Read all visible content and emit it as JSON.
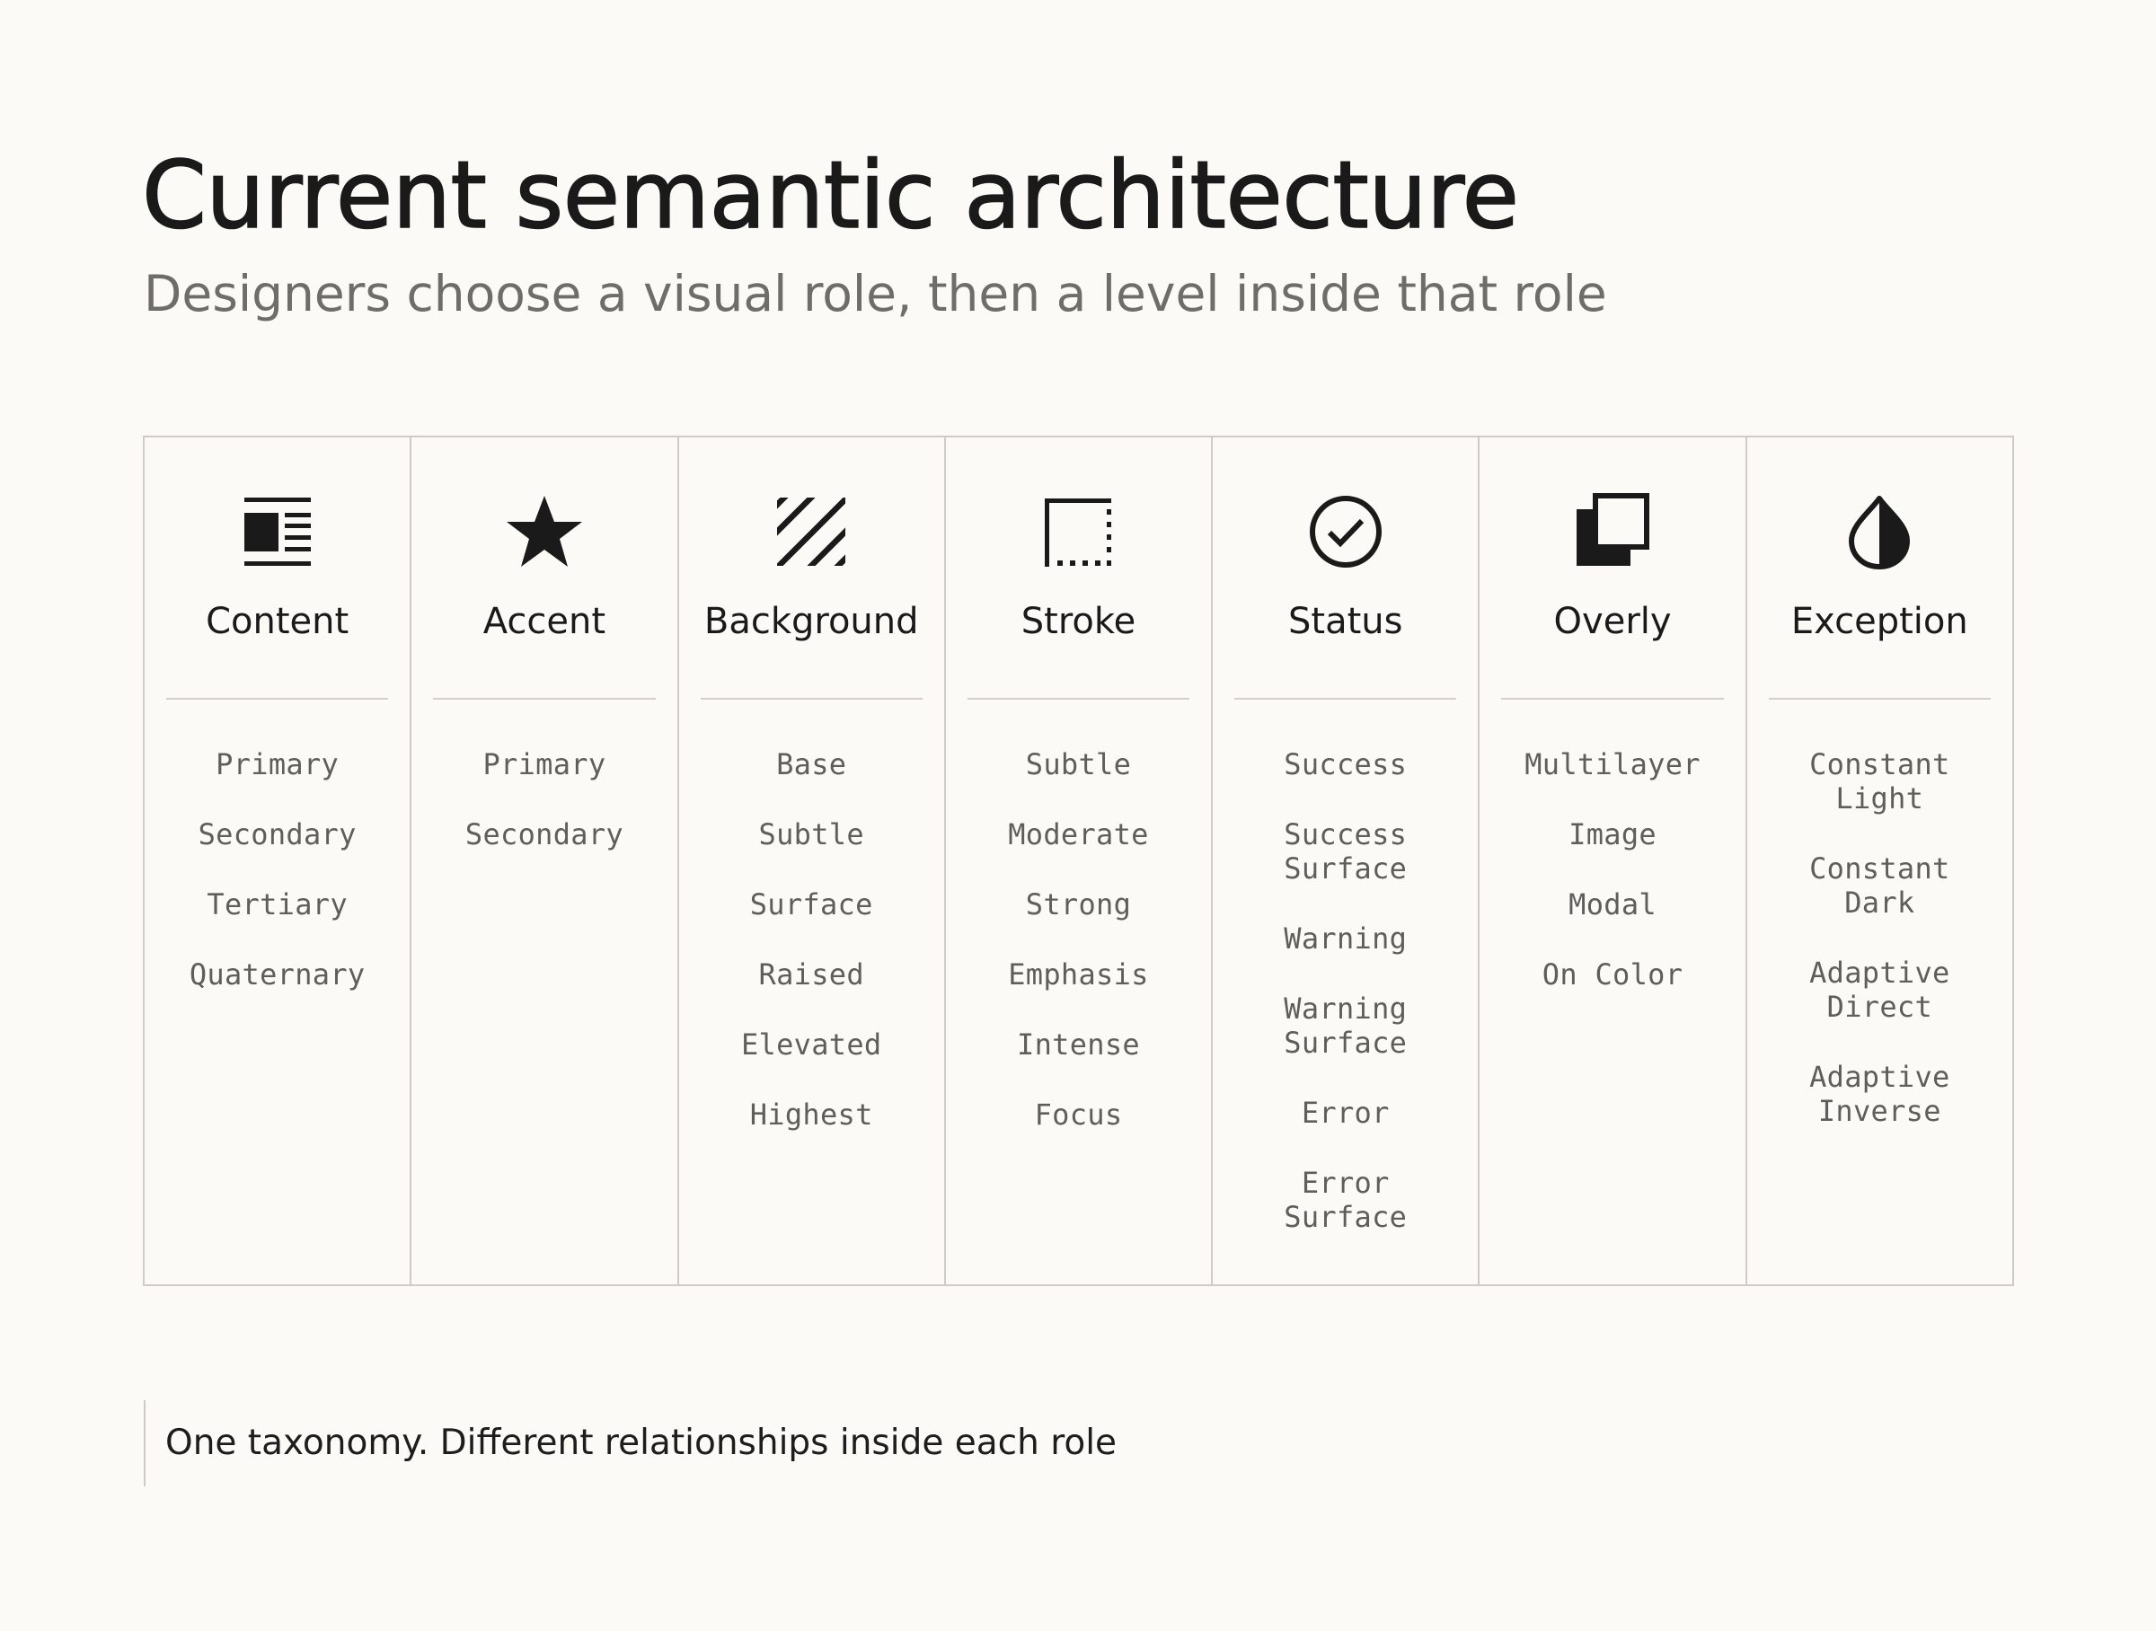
{
  "header": {
    "title": "Current semantic architecture",
    "subtitle": "Designers choose a visual role, then a level inside that role"
  },
  "roles": [
    {
      "name": "Content",
      "icon": "text-block-icon",
      "levels": [
        "Primary",
        "Secondary",
        "Tertiary",
        "Quaternary"
      ]
    },
    {
      "name": "Accent",
      "icon": "star-icon",
      "levels": [
        "Primary",
        "Secondary"
      ]
    },
    {
      "name": "Background",
      "icon": "diagonal-hatch-icon",
      "levels": [
        "Base",
        "Subtle",
        "Surface",
        "Raised",
        "Elevated",
        "Highest"
      ]
    },
    {
      "name": "Stroke",
      "icon": "partial-border-icon",
      "levels": [
        "Subtle",
        "Moderate",
        "Strong",
        "Emphasis",
        "Intense",
        "Focus"
      ]
    },
    {
      "name": "Status",
      "icon": "check-circle-icon",
      "levels": [
        "Success",
        "Success\nSurface",
        "Warning",
        "Warning\nSurface",
        "Error",
        "Error\nSurface"
      ]
    },
    {
      "name": "Overly",
      "icon": "stacked-layers-icon",
      "levels": [
        "Multilayer",
        "Image",
        "Modal",
        "On Color"
      ]
    },
    {
      "name": "Exception",
      "icon": "half-drop-icon",
      "levels": [
        "Constant\nLight",
        "Constant\nDark",
        "Adaptive\nDirect",
        "Adaptive\nInverse"
      ]
    }
  ],
  "footer": {
    "note": "One taxonomy. Different relationships inside each role"
  },
  "colors": {
    "background": "#fbfaf7",
    "text": "#1a1a1a",
    "muted_text": "#6f6d69",
    "border": "#cfccc6"
  }
}
